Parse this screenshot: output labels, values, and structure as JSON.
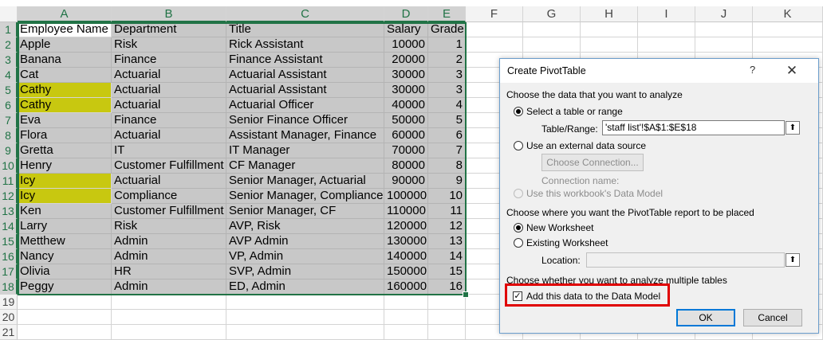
{
  "columns": [
    "A",
    "B",
    "C",
    "D",
    "E",
    "F",
    "G",
    "H",
    "I",
    "J",
    "K"
  ],
  "rows": [
    "1",
    "2",
    "3",
    "4",
    "5",
    "6",
    "7",
    "8",
    "9",
    "10",
    "11",
    "12",
    "13",
    "14",
    "15",
    "16",
    "17",
    "18",
    "19",
    "20",
    "21"
  ],
  "headers": [
    "Employee Name",
    "Department",
    "Title",
    "Salary",
    "Grade"
  ],
  "table": [
    [
      "Apple",
      "Risk",
      "Rick Assistant",
      "10000",
      "1"
    ],
    [
      "Banana",
      "Finance",
      "Finance Assistant",
      "20000",
      "2"
    ],
    [
      "Cat",
      "Actuarial",
      "Actuarial Assistant",
      "30000",
      "3"
    ],
    [
      "Cathy",
      "Actuarial",
      "Actuarial Assistant",
      "30000",
      "3"
    ],
    [
      "Cathy",
      "Actuarial",
      "Actuarial Officer",
      "40000",
      "4"
    ],
    [
      "Eva",
      "Finance",
      "Senior Finance Officer",
      "50000",
      "5"
    ],
    [
      "Flora",
      "Actuarial",
      "Assistant Manager, Finance",
      "60000",
      "6"
    ],
    [
      "Gretta",
      "IT",
      "IT Manager",
      "70000",
      "7"
    ],
    [
      "Henry",
      "Customer Fulfillment",
      "CF Manager",
      "80000",
      "8"
    ],
    [
      "Icy",
      "Actuarial",
      "Senior Manager, Actuarial",
      "90000",
      "9"
    ],
    [
      "Icy",
      "Compliance",
      "Senior Manager, Compliance",
      "100000",
      "10"
    ],
    [
      "Ken",
      "Customer Fulfillment",
      "Senior Manager, CF",
      "110000",
      "11"
    ],
    [
      "Larry",
      "Risk",
      "AVP, Risk",
      "120000",
      "12"
    ],
    [
      "Metthew",
      "Admin",
      "AVP Admin",
      "130000",
      "13"
    ],
    [
      "Nancy",
      "Admin",
      "VP, Admin",
      "140000",
      "14"
    ],
    [
      "Olivia",
      "HR",
      "SVP, Admin",
      "150000",
      "15"
    ],
    [
      "Peggy",
      "Admin",
      "ED, Admin",
      "160000",
      "16"
    ]
  ],
  "highlight_rows": [
    3,
    4,
    9,
    10
  ],
  "colors": {
    "selection": "#217346",
    "highlight": "#c8c810",
    "shade": "#c8c8c8",
    "redbox": "#e00000"
  },
  "dialog": {
    "title": "Create PivotTable",
    "help": "?",
    "close": "✕",
    "section1": "Choose the data that you want to analyze",
    "opt_select_range": "Select a table or range",
    "table_range_label": "Table/Range:",
    "table_range_value": "'staff list'!$A$1:$E$18",
    "opt_external": "Use an external data source",
    "choose_connection": "Choose Connection...",
    "connection_name": "Connection name:",
    "opt_data_model": "Use this workbook's Data Model",
    "section2": "Choose where you want the PivotTable report to be placed",
    "opt_new_ws": "New Worksheet",
    "opt_existing_ws": "Existing Worksheet",
    "location_label": "Location:",
    "location_value": "",
    "section3": "Choose whether you want to analyze multiple tables",
    "add_data_model": "Add this data to the Data Model",
    "ok": "OK",
    "cancel": "Cancel"
  }
}
